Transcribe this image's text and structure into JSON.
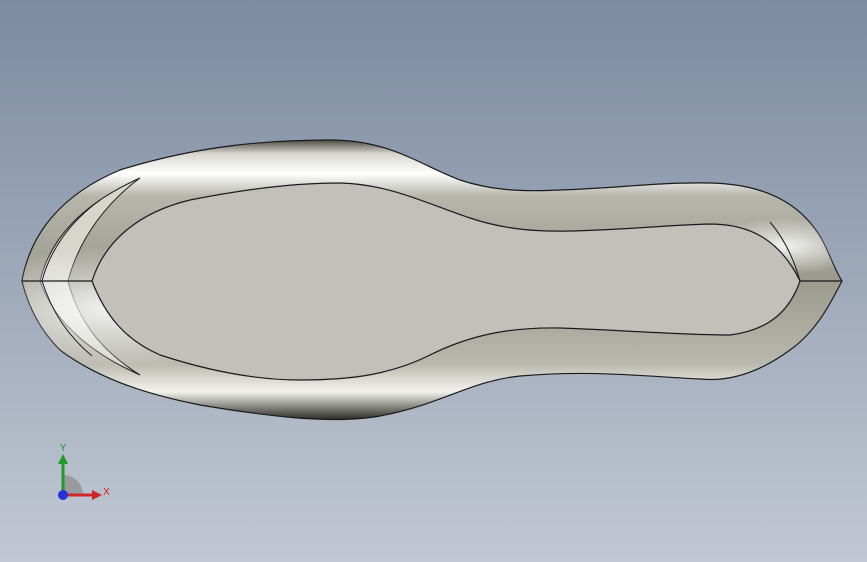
{
  "triad": {
    "y_label": "Y",
    "x_label": "X"
  },
  "colors": {
    "background_top": "#7c8ba1",
    "background_bottom": "#c2c8d3",
    "model_face": "#c1c1ba",
    "model_edge": "#1a1a1a",
    "axis_x": "#d0262a",
    "axis_y": "#1f9a2c",
    "axis_z": "#2432d8"
  },
  "icons": [
    "coordinate-triad-icon"
  ]
}
